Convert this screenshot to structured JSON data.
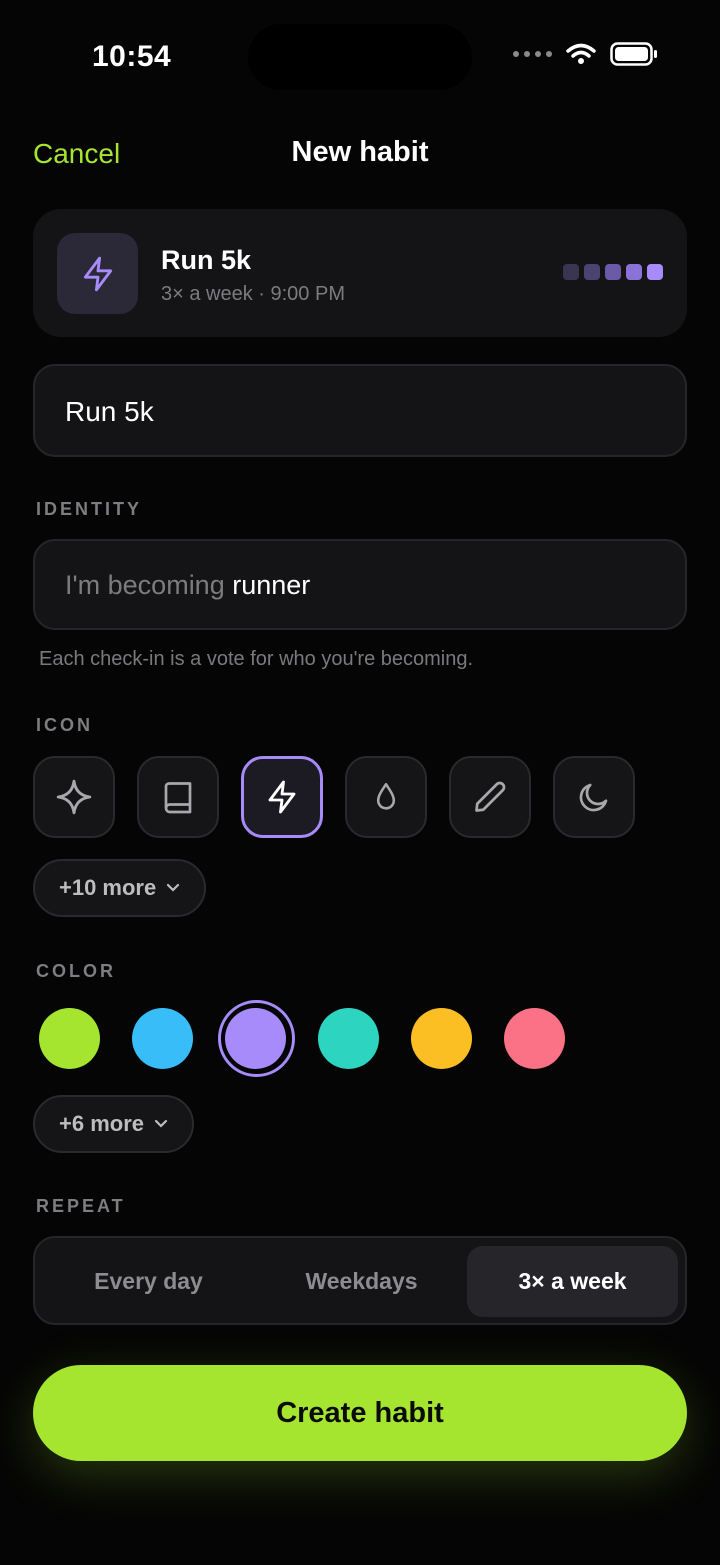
{
  "status_bar": {
    "time": "10:54"
  },
  "nav": {
    "cancel": "Cancel",
    "title": "New habit"
  },
  "preview": {
    "name": "Run 5k",
    "subtitle": "3× a week · 9:00 PM",
    "icon": "bolt-icon",
    "progress_colors": [
      "#3a3550",
      "#4b4470",
      "#6a5aa8",
      "#8a72d8",
      "#a78bfa"
    ]
  },
  "name_field": {
    "value": "Run 5k"
  },
  "identity": {
    "label": "IDENTITY",
    "prefix": "I'm becoming",
    "value": "runner",
    "hint": "Each check-in is a vote for who you're becoming."
  },
  "icon_section": {
    "label": "ICON",
    "icons": [
      "sparkle-icon",
      "book-icon",
      "bolt-icon",
      "drop-icon",
      "pencil-icon",
      "moon-icon"
    ],
    "selected": "bolt-icon",
    "more": "+10 more"
  },
  "color_section": {
    "label": "COLOR",
    "colors": [
      "#a6e52f",
      "#38bdf8",
      "#a78bfa",
      "#2dd4bf",
      "#fbbf24",
      "#fb7185"
    ],
    "selected": "#a78bfa",
    "more": "+6 more"
  },
  "repeat": {
    "label": "REPEAT",
    "options": [
      "Every day",
      "Weekdays",
      "3× a week"
    ],
    "selected": "3× a week"
  },
  "create_button": "Create habit",
  "accent": "#a6e52f",
  "highlight": "#a78bfa"
}
